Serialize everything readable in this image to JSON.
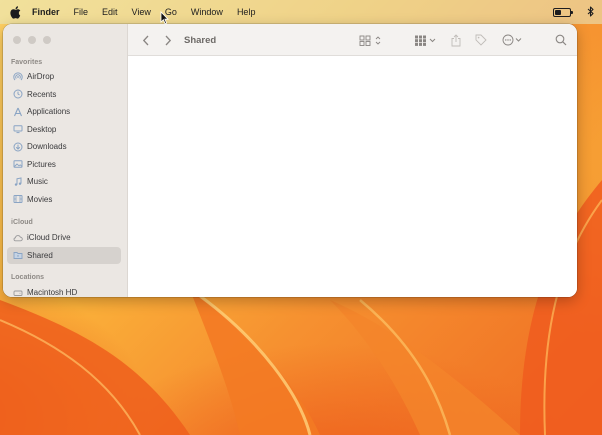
{
  "menubar": {
    "app_name": "Finder",
    "items": [
      "File",
      "Edit",
      "View",
      "Go",
      "Window",
      "Help"
    ],
    "battery_level": 0.45
  },
  "window": {
    "title": "Shared",
    "sidebar": {
      "favorites_label": "Favorites",
      "favorites": [
        {
          "label": "AirDrop",
          "icon": "airdrop-icon"
        },
        {
          "label": "Recents",
          "icon": "clock-icon"
        },
        {
          "label": "Applications",
          "icon": "applications-icon"
        },
        {
          "label": "Desktop",
          "icon": "desktop-icon"
        },
        {
          "label": "Downloads",
          "icon": "download-icon"
        },
        {
          "label": "Pictures",
          "icon": "photo-icon"
        },
        {
          "label": "Music",
          "icon": "music-icon"
        },
        {
          "label": "Movies",
          "icon": "film-icon"
        }
      ],
      "icloud_label": "iCloud",
      "icloud": [
        {
          "label": "iCloud Drive",
          "icon": "cloud-icon"
        },
        {
          "label": "Shared",
          "icon": "shared-folder-icon",
          "selected": true
        }
      ],
      "locations_label": "Locations",
      "locations": [
        {
          "label": "Macintosh HD",
          "icon": "disk-icon"
        }
      ]
    }
  },
  "colors": {
    "sidebar_bg": "#ebe7e3",
    "selection": "#d6d2ce",
    "sidebar_icon": "#8aa4c4",
    "wallpaper_orange": "#f69130"
  }
}
